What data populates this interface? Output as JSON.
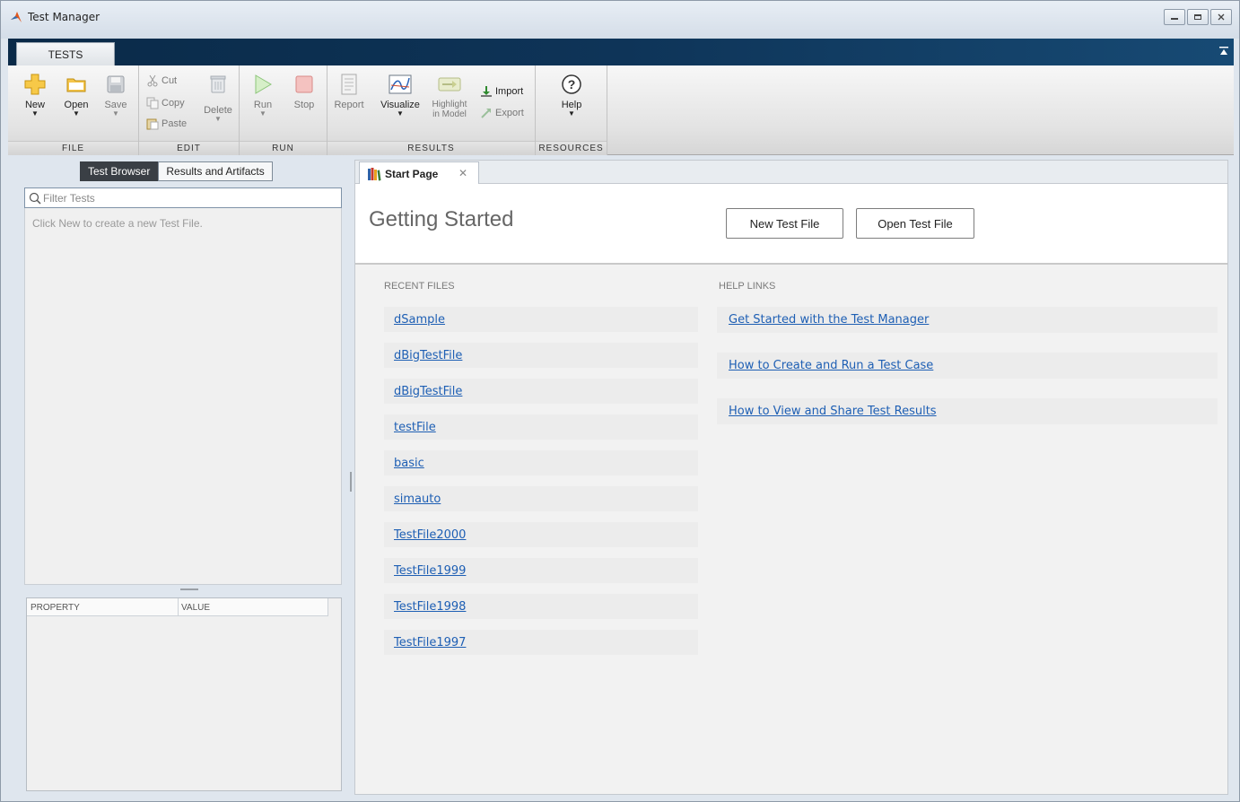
{
  "window": {
    "title": "Test Manager"
  },
  "ribbon": {
    "tab_label": "TESTS",
    "groups": {
      "file": "FILE",
      "edit": "EDIT",
      "run": "RUN",
      "results": "RESULTS",
      "resources": "RESOURCES"
    },
    "buttons": {
      "new": "New",
      "open": "Open",
      "save": "Save",
      "cut": "Cut",
      "copy": "Copy",
      "paste": "Paste",
      "delete": "Delete",
      "run": "Run",
      "stop": "Stop",
      "report": "Report",
      "visualize": "Visualize",
      "highlight_line1": "Highlight",
      "highlight_line2": "in Model",
      "import": "Import",
      "export": "Export",
      "help": "Help"
    }
  },
  "left_panel": {
    "tabs": [
      "Test Browser",
      "Results and Artifacts"
    ],
    "filter_placeholder": "Filter Tests",
    "empty_hint": "Click New to create a new Test File.",
    "property_columns": [
      "PROPERTY",
      "VALUE"
    ]
  },
  "start_page": {
    "tab_label": "Start Page",
    "heading": "Getting Started",
    "new_test_file_button": "New Test File",
    "open_test_file_button": "Open Test File",
    "recent_files_title": "RECENT FILES",
    "recent_files": [
      "dSample",
      "dBigTestFile",
      "dBigTestFile",
      "testFile",
      "basic",
      "simauto",
      "TestFile2000",
      "TestFile1999",
      "TestFile1998",
      "TestFile1997"
    ],
    "help_links_title": "HELP LINKS",
    "help_links": [
      "Get Started with the Test Manager",
      "How to Create and Run a Test Case",
      "How to View and Share Test Results"
    ]
  },
  "colors": {
    "tabstrip_dark": "#0e3458",
    "link_blue": "#1e5fb4",
    "active_tab": "#3a3f45"
  }
}
